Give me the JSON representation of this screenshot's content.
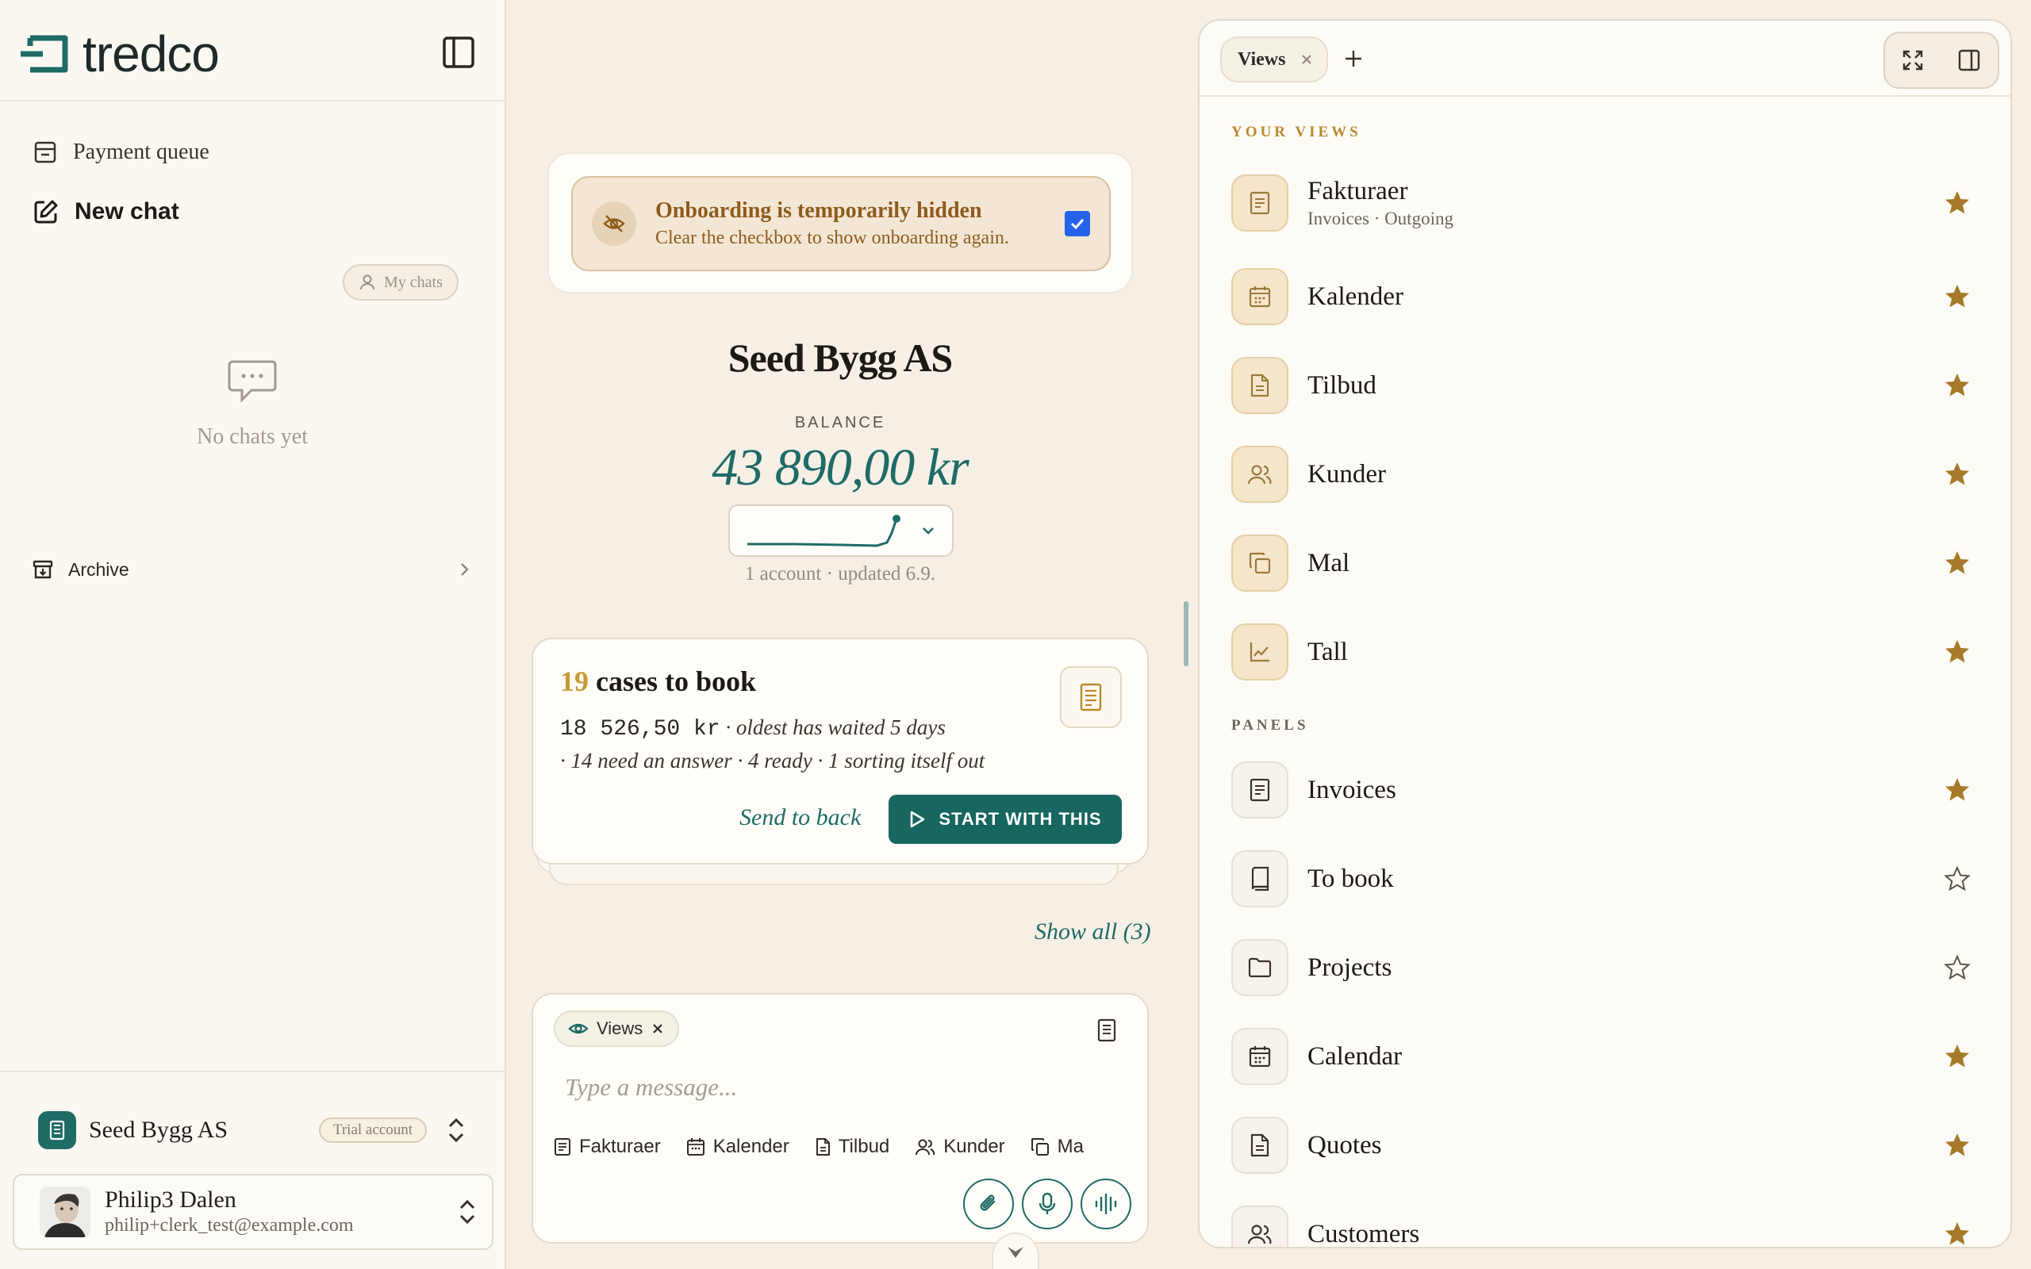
{
  "brand": {
    "name": "tredco",
    "color": "#1f6b66",
    "accent_gold": "#b88a2e"
  },
  "sidebar": {
    "nav": {
      "payment_queue": "Payment queue",
      "new_chat": "New chat"
    },
    "my_chats_label": "My chats",
    "empty_text": "No chats yet",
    "archive_label": "Archive",
    "org": {
      "name": "Seed Bygg AS",
      "badge": "Trial account"
    },
    "user": {
      "name": "Philip3 Dalen",
      "email": "philip+clerk_test@example.com"
    }
  },
  "onboarding": {
    "title": "Onboarding is temporarily hidden",
    "subtitle": "Clear the checkbox to show onboarding again.",
    "checked": true
  },
  "company": {
    "name": "Seed Bygg AS",
    "balance_label": "BALANCE",
    "balance": "43 890,00 kr",
    "account_info": "1 account · updated 6.9."
  },
  "cases": {
    "count": "19",
    "title_rest": " cases to book",
    "amount": "18 526,50 kr",
    "waited": " · oldest has waited 5 days",
    "details": "· 14 need an answer · 4 ready · 1 sorting itself out",
    "send_back": "Send to back",
    "start": "START WITH THIS",
    "show_all": "Show all (3)"
  },
  "composer": {
    "context_chip": "Views",
    "placeholder": "Type a message...",
    "quick_items": [
      {
        "label": "Fakturaer",
        "icon": "invoice-icon"
      },
      {
        "label": "Kalender",
        "icon": "calendar-icon"
      },
      {
        "label": "Tilbud",
        "icon": "file-icon"
      },
      {
        "label": "Kunder",
        "icon": "users-icon"
      },
      {
        "label": "Ma",
        "icon": "copy-icon"
      }
    ]
  },
  "panel": {
    "tab_label": "Views",
    "your_views_label": "YOUR VIEWS",
    "panels_label": "PANELS",
    "your_views": [
      {
        "title": "Fakturaer",
        "subtitle": "Invoices · Outgoing",
        "icon": "invoice-icon",
        "starred": true
      },
      {
        "title": "Kalender",
        "icon": "calendar-icon",
        "starred": true
      },
      {
        "title": "Tilbud",
        "icon": "file-icon",
        "starred": true
      },
      {
        "title": "Kunder",
        "icon": "users-icon",
        "starred": true
      },
      {
        "title": "Mal",
        "icon": "copy-icon",
        "starred": true
      },
      {
        "title": "Tall",
        "icon": "chart-icon",
        "starred": true
      }
    ],
    "panels": [
      {
        "title": "Invoices",
        "icon": "invoice-icon",
        "starred": true
      },
      {
        "title": "To book",
        "icon": "book-icon",
        "starred": false
      },
      {
        "title": "Projects",
        "icon": "folder-icon",
        "starred": false
      },
      {
        "title": "Calendar",
        "icon": "calendar-icon",
        "starred": true
      },
      {
        "title": "Quotes",
        "icon": "file-icon",
        "starred": true
      },
      {
        "title": "Customers",
        "icon": "users-icon",
        "starred": true
      }
    ]
  }
}
